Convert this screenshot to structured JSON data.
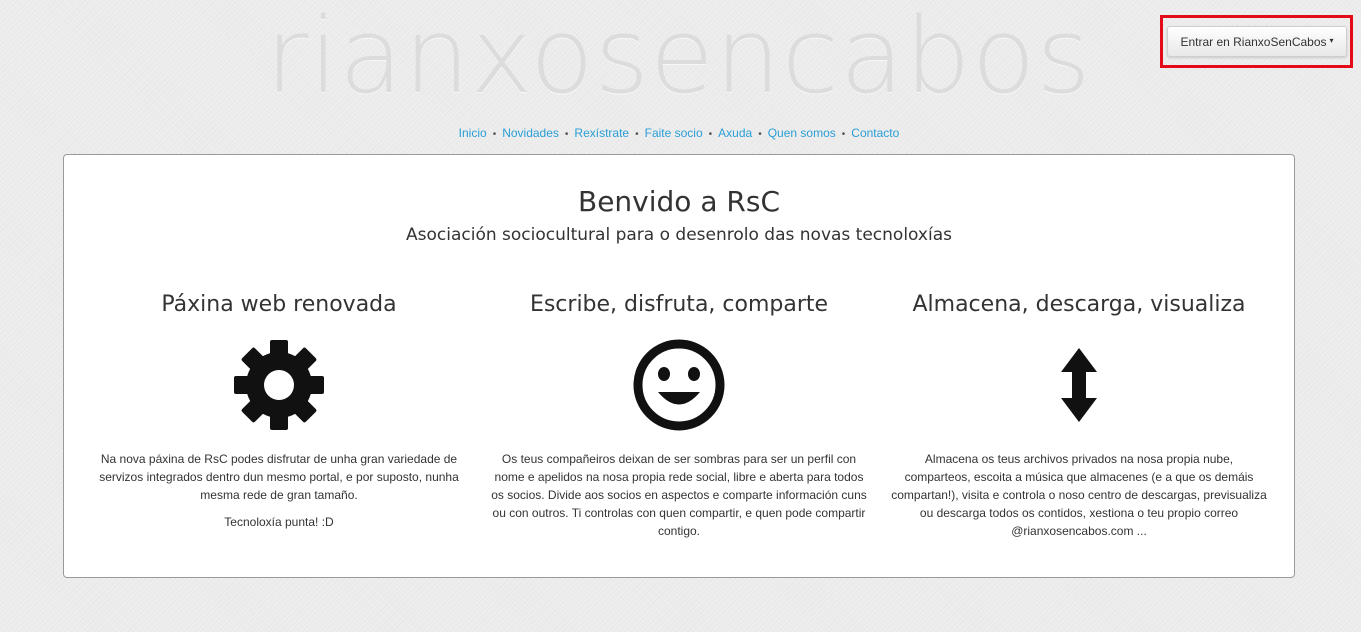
{
  "site": {
    "logo_text": "rianxosencabos"
  },
  "login": {
    "label": "Entrar en RianxoSenCabos",
    "caret": "▾"
  },
  "nav": {
    "items": [
      "Inicio",
      "Novidades",
      "Rexístrate",
      "Faite socio",
      "Axuda",
      "Quen somos",
      "Contacto"
    ],
    "separator": "•"
  },
  "welcome": {
    "title": "Benvido a RsC",
    "subtitle": "Asociación sociocultural para o desenrolo das novas tecnoloxías"
  },
  "features": [
    {
      "title": "Páxina web renovada",
      "icon": "gear-icon",
      "text": "Na nova páxina de RsC podes disfrutar de unha gran variedade de servizos integrados dentro dun mesmo portal, e por suposto, nunha mesma rede de gran tamaño.",
      "note": "Tecnoloxía punta! :D"
    },
    {
      "title": "Escribe, disfruta, comparte",
      "icon": "smiley-icon",
      "text": "Os teus compañeiros deixan de ser sombras para ser un perfil con nome e apelidos na nosa propia rede social, libre e aberta para todos os socios. Divide aos socios en aspectos e comparte información cuns ou con outros. Ti controlas con quen compartir, e quen pode compartir contigo."
    },
    {
      "title": "Almacena, descarga, visualiza",
      "icon": "up-down-arrow-icon",
      "text": "Almacena os teus archivos privados na nosa propia nube, comparteos, escoita a música que almacenes (e a que os demáis compartan!), visita e controla o noso centro de descargas, previsualiza ou descarga todos os contidos, xestiona o teu propio correo @rianxosencabos.com ..."
    }
  ]
}
